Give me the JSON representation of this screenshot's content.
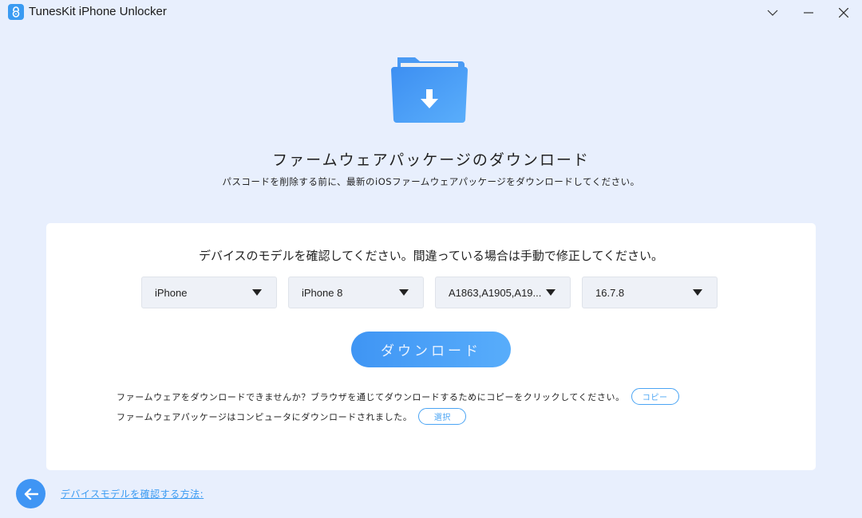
{
  "window": {
    "title": "TunesKit iPhone Unlocker",
    "controls": [
      "dropdown-menu",
      "minimize",
      "close"
    ]
  },
  "header": {
    "icon": "folder-download-icon",
    "title": "ファームウェアパッケージのダウンロード",
    "subtitle": "パスコードを削除する前に、最新のiOSファームウェアパッケージをダウンロードしてください。"
  },
  "card": {
    "instruction": "デバイスのモデルを確認してください。間違っている場合は手動で修正してください。",
    "selects": [
      {
        "name": "device-type",
        "value": "iPhone"
      },
      {
        "name": "device-model",
        "value": "iPhone 8"
      },
      {
        "name": "model-number",
        "value": "A1863,A1905,A19..."
      },
      {
        "name": "ios-version",
        "value": "16.7.8"
      }
    ],
    "download_label": "ダウンロード",
    "note_copy": "ファームウェアをダウンロードできませんか？ブラウザを通じてダウンロードするためにコピーをクリックしてください。",
    "copy_label": "コピー",
    "note_select": "ファームウェアパッケージはコンピュータにダウンロードされました。",
    "select_label": "選択"
  },
  "footer": {
    "back_icon": "arrow-left-icon",
    "help_link": "デバイスモデルを確認する方法:"
  },
  "colors": {
    "background": "#e8effd",
    "accent": "#3f95f4",
    "card": "#ffffff"
  }
}
